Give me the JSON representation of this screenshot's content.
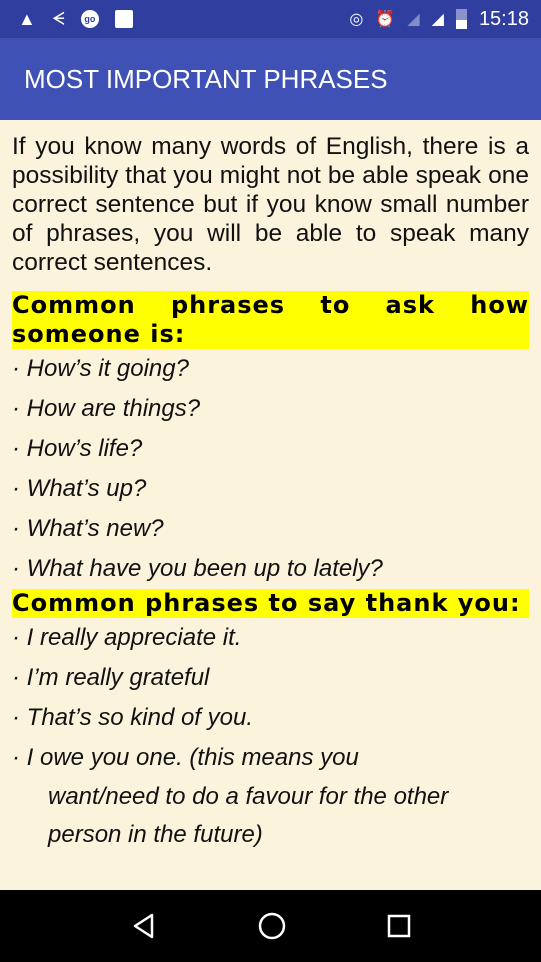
{
  "status_bar": {
    "time": "15:18",
    "icons": [
      "warning-icon",
      "bird-icon",
      "go-icon",
      "image-icon",
      "hotspot-icon",
      "alarm-icon",
      "signal-empty-icon",
      "signal-icon",
      "battery-icon"
    ]
  },
  "app_bar": {
    "title": "MOST IMPORTANT PHRASES"
  },
  "content": {
    "intro": "If you know many words of English, there is a possibility that you might not be able speak one correct sentence but if you know small number of phrases, you will be able to speak many correct sentences.",
    "sections": [
      {
        "heading": "Common phrases to ask how someone is:",
        "items": [
          "· How’s it going?",
          "· How are things?",
          "· How’s life?",
          "· What’s up?",
          "· What’s new?",
          "· What have you been up to lately?"
        ]
      },
      {
        "heading": "Common phrases to say thank you:",
        "items": [
          "· I really appreciate it.",
          "· I’m really grateful",
          "· That’s so kind of you.",
          "· I owe you one. (this means you"
        ],
        "continuation": [
          "want/need to do a favour for the other",
          "person in the future)"
        ]
      }
    ]
  },
  "colors": {
    "status_bar": "#303f9f",
    "app_bar": "#3f51b5",
    "highlight": "#ffff00",
    "background": "#fbf3dc"
  }
}
